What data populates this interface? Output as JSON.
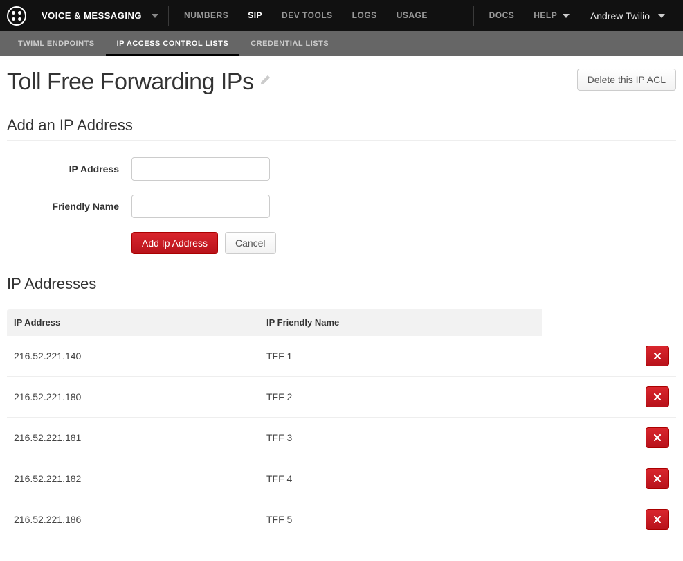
{
  "topnav": {
    "section": "VOICE & MESSAGING",
    "links": [
      {
        "label": "NUMBERS",
        "active": false
      },
      {
        "label": "SIP",
        "active": true
      },
      {
        "label": "DEV TOOLS",
        "active": false
      },
      {
        "label": "LOGS",
        "active": false
      },
      {
        "label": "USAGE",
        "active": false
      }
    ],
    "docs": "DOCS",
    "help": "HELP",
    "user": "Andrew Twilio"
  },
  "subnav": {
    "tabs": [
      {
        "label": "TWIML ENDPOINTS",
        "active": false
      },
      {
        "label": "IP ACCESS CONTROL LISTS",
        "active": true
      },
      {
        "label": "CREDENTIAL LISTS",
        "active": false
      }
    ]
  },
  "page": {
    "title": "Toll Free Forwarding IPs",
    "delete_button": "Delete this IP ACL",
    "add_section_title": "Add an IP Address",
    "form": {
      "ip_label": "IP Address",
      "name_label": "Friendly Name",
      "submit_label": "Add Ip Address",
      "cancel_label": "Cancel",
      "ip_value": "",
      "name_value": ""
    },
    "list_section_title": "IP Addresses",
    "table": {
      "col_ip": "IP Address",
      "col_name": "IP Friendly Name",
      "rows": [
        {
          "ip": "216.52.221.140",
          "name": "TFF 1"
        },
        {
          "ip": "216.52.221.180",
          "name": "TFF 2"
        },
        {
          "ip": "216.52.221.181",
          "name": "TFF 3"
        },
        {
          "ip": "216.52.221.182",
          "name": "TFF 4"
        },
        {
          "ip": "216.52.221.186",
          "name": "TFF 5"
        }
      ]
    }
  }
}
